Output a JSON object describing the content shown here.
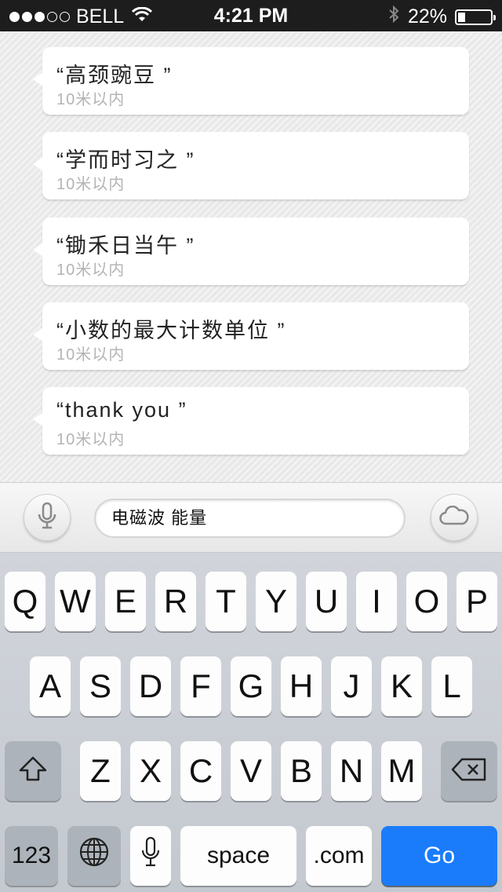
{
  "status_bar": {
    "carrier": "BELL",
    "time": "4:21 PM",
    "battery_percent": "22%",
    "battery_level": 0.22,
    "signal_dots_filled": 3,
    "signal_dots_total": 5
  },
  "results": [
    {
      "title": "“高颈豌豆 ”",
      "distance": "10米以内"
    },
    {
      "title": "“学而时习之 ”",
      "distance": "10米以内"
    },
    {
      "title": "“锄禾日当午 ”",
      "distance": "10米以内"
    },
    {
      "title": "“小数的最大计数单位 ”",
      "distance": "10米以内"
    },
    {
      "title": "“thank you ”",
      "distance": "10米以内"
    }
  ],
  "input_bar": {
    "text_value": "电磁波 能量",
    "mic_icon": "microphone-icon",
    "cloud_icon": "cloud-icon"
  },
  "keyboard": {
    "row1": [
      "Q",
      "W",
      "E",
      "R",
      "T",
      "Y",
      "U",
      "I",
      "O",
      "P"
    ],
    "row2": [
      "A",
      "S",
      "D",
      "F",
      "G",
      "H",
      "J",
      "K",
      "L"
    ],
    "row3": [
      "Z",
      "X",
      "C",
      "V",
      "B",
      "N",
      "M"
    ],
    "numbers_label": "123",
    "space_label": "space",
    "dotcom_label": ".com",
    "go_label": "Go",
    "go_color": "#1a7cfb"
  }
}
